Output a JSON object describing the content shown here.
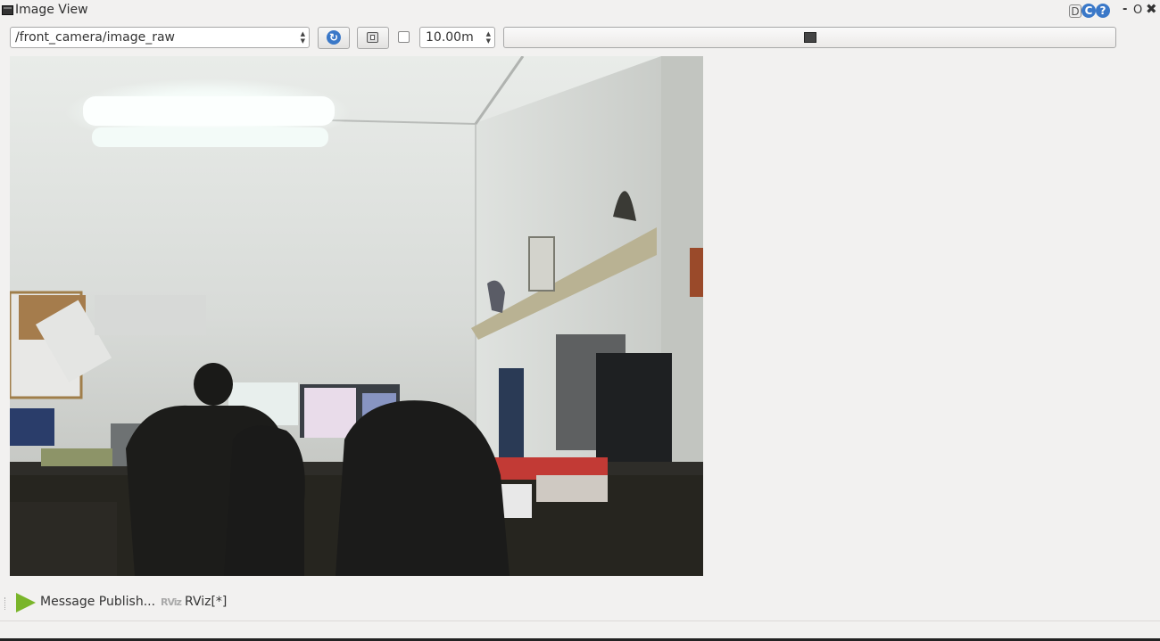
{
  "window": {
    "title": "Image View",
    "controls": {
      "d_label": "D",
      "c_label": "C",
      "help_label": "?",
      "minimize_label": "-",
      "float_label": "O",
      "close_label": "✖"
    }
  },
  "toolbar": {
    "topic_value": "/front_camera/image_raw",
    "refresh_icon": "↻",
    "smooth_checked": false,
    "rotation_value": "10.00m",
    "slider_value": 0.5
  },
  "bottom_bar": {
    "plugins": [
      {
        "icon": "play-icon",
        "label": "Message Publish..."
      },
      {
        "icon": "rviz-icon",
        "icon_text": "RViz",
        "label": "RViz[*]"
      }
    ]
  },
  "colors": {
    "background": "#f2f1f0",
    "accent_blue": "#3a78c8",
    "play_green": "#7ab52a"
  }
}
